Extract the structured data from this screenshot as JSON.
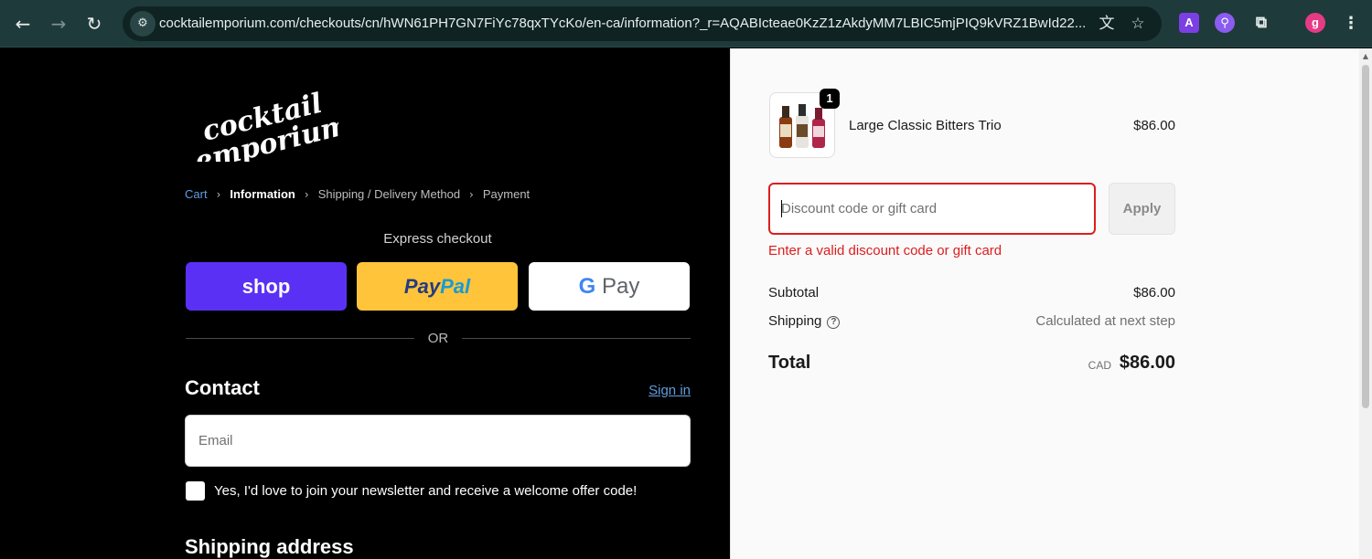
{
  "browser": {
    "back_icon": "←",
    "forward_icon": "→",
    "reload_icon": "↻",
    "site_info_icon": "⚙",
    "url": "cocktailemporium.com/checkouts/cn/hWN61PH7GN7FiYc78qxTYcKo/en-ca/information?_r=AQABIcteae0KzZ1zAkdyMM7LBIC5mjPIQ9kVRZ1BwId22...",
    "translate_icon": "文",
    "star_icon": "☆",
    "ext1_label": "A",
    "ext2_label": "⚲",
    "puzzle_icon": "⧉",
    "profile_initial": "g",
    "menu_icon": "⋮"
  },
  "logo": {
    "line1": "cocktail",
    "line2": "emporium"
  },
  "breadcrumb": {
    "cart": "Cart",
    "information": "Information",
    "shipping": "Shipping / Delivery Method",
    "payment": "Payment",
    "separator": "›"
  },
  "express": {
    "title": "Express checkout",
    "shop_label": "shop",
    "paypal_part1": "Pay",
    "paypal_part2": "Pal",
    "gpay_g": "G",
    "gpay_label": " Pay",
    "or_label": "OR"
  },
  "contact": {
    "title": "Contact",
    "sign_in": "Sign in",
    "email_placeholder": "Email",
    "newsletter_label": "Yes, I'd love to join your newsletter and receive a welcome offer code!",
    "newsletter_checked": false
  },
  "shipping_address": {
    "title": "Shipping address"
  },
  "summary": {
    "item": {
      "name": "Large Classic Bitters Trio",
      "price": "$86.00",
      "quantity": "1"
    },
    "discount": {
      "placeholder": "Discount code or gift card",
      "apply_label": "Apply",
      "error": "Enter a valid discount code or gift card"
    },
    "subtotal_label": "Subtotal",
    "subtotal_value": "$86.00",
    "shipping_label": "Shipping",
    "shipping_help": "?",
    "shipping_value": "Calculated at next step",
    "total_label": "Total",
    "total_currency": "CAD",
    "total_value": "$86.00"
  },
  "colors": {
    "accent_link": "#5f9ee0",
    "shop_pay": "#5a31f4",
    "paypal": "#ffc439",
    "error": "#dd1d1d"
  }
}
